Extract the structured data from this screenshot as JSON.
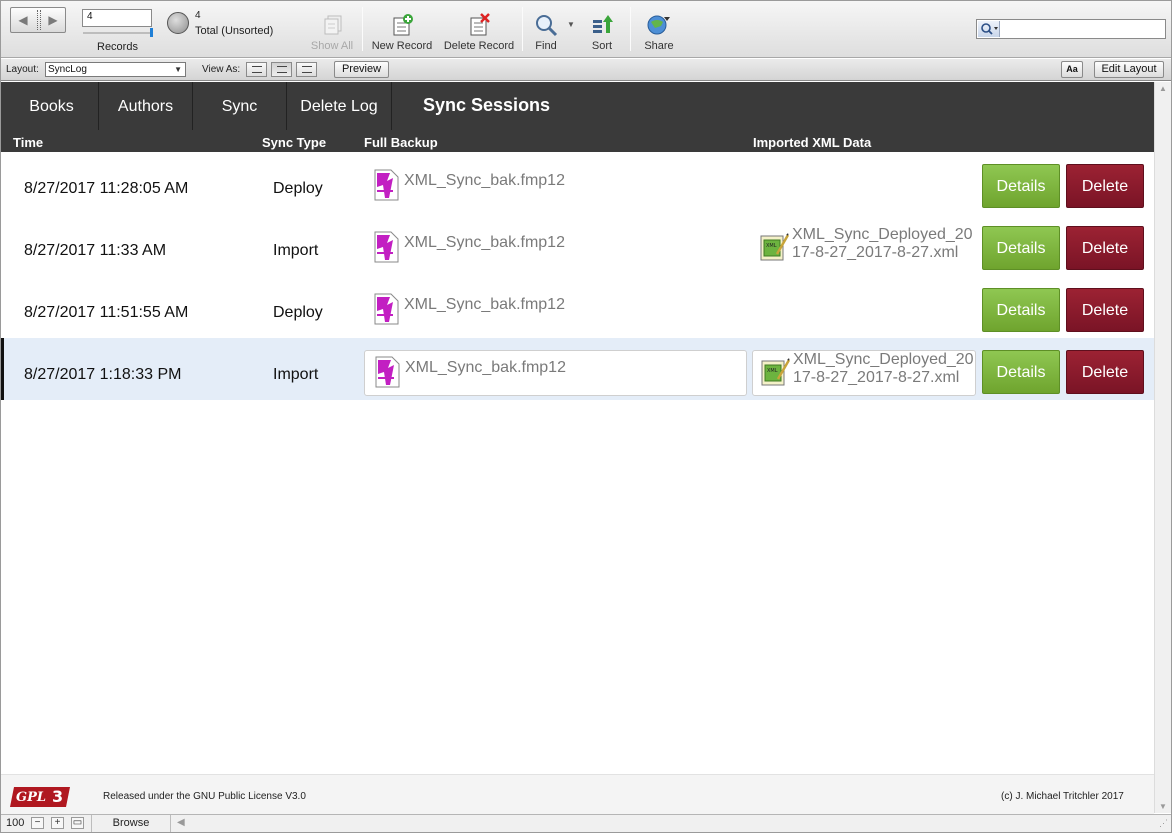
{
  "toolbar": {
    "record_current": "4",
    "records_label": "Records",
    "found_count": "4",
    "found_status": "Total (Unsorted)",
    "show_all": "Show All",
    "new_record": "New Record",
    "delete_record": "Delete Record",
    "find": "Find",
    "sort": "Sort",
    "share": "Share",
    "quick_find_value": ""
  },
  "layoutbar": {
    "layout_label": "Layout:",
    "layout_value": "SyncLog",
    "view_as_label": "View As:",
    "preview": "Preview",
    "aa": "Aa",
    "edit_layout": "Edit Layout"
  },
  "nav": {
    "tabs": [
      "Books",
      "Authors",
      "Sync",
      "Delete Log"
    ],
    "title": "Sync Sessions"
  },
  "columns": {
    "time": "Time",
    "sync_type": "Sync Type",
    "full_backup": "Full Backup",
    "imported_xml": "Imported XML Data"
  },
  "rows": [
    {
      "time": "8/27/2017 11:28:05 AM",
      "type": "Deploy",
      "backup": "XML_Sync_bak.fmp12",
      "xml": "",
      "details": "Details",
      "delete": "Delete"
    },
    {
      "time": "8/27/2017 11:33 AM",
      "type": "Import",
      "backup": "XML_Sync_bak.fmp12",
      "xml": "XML_Sync_Deployed_2017-8-27_2017-8-27.xml",
      "details": "Details",
      "delete": "Delete"
    },
    {
      "time": "8/27/2017 11:51:55 AM",
      "type": "Deploy",
      "backup": "XML_Sync_bak.fmp12",
      "xml": "",
      "details": "Details",
      "delete": "Delete"
    },
    {
      "time": "8/27/2017 1:18:33 PM",
      "type": "Import",
      "backup": "XML_Sync_bak.fmp12",
      "xml": "XML_Sync_Deployed_2017-8-27_2017-8-27.xml",
      "details": "Details",
      "delete": "Delete"
    }
  ],
  "footer": {
    "gpl_logo_text": "GPLv3",
    "license": "Released under the GNU Public License V3.0",
    "copyright": "(c) J. Michael Tritchler 2017"
  },
  "statusbar": {
    "zoom": "100",
    "mode": "Browse"
  },
  "colors": {
    "header_bg": "#3a3a3a",
    "details_green": "#7cb53c",
    "delete_maroon": "#8a1a2c",
    "selected_row": "#e4edf8"
  }
}
